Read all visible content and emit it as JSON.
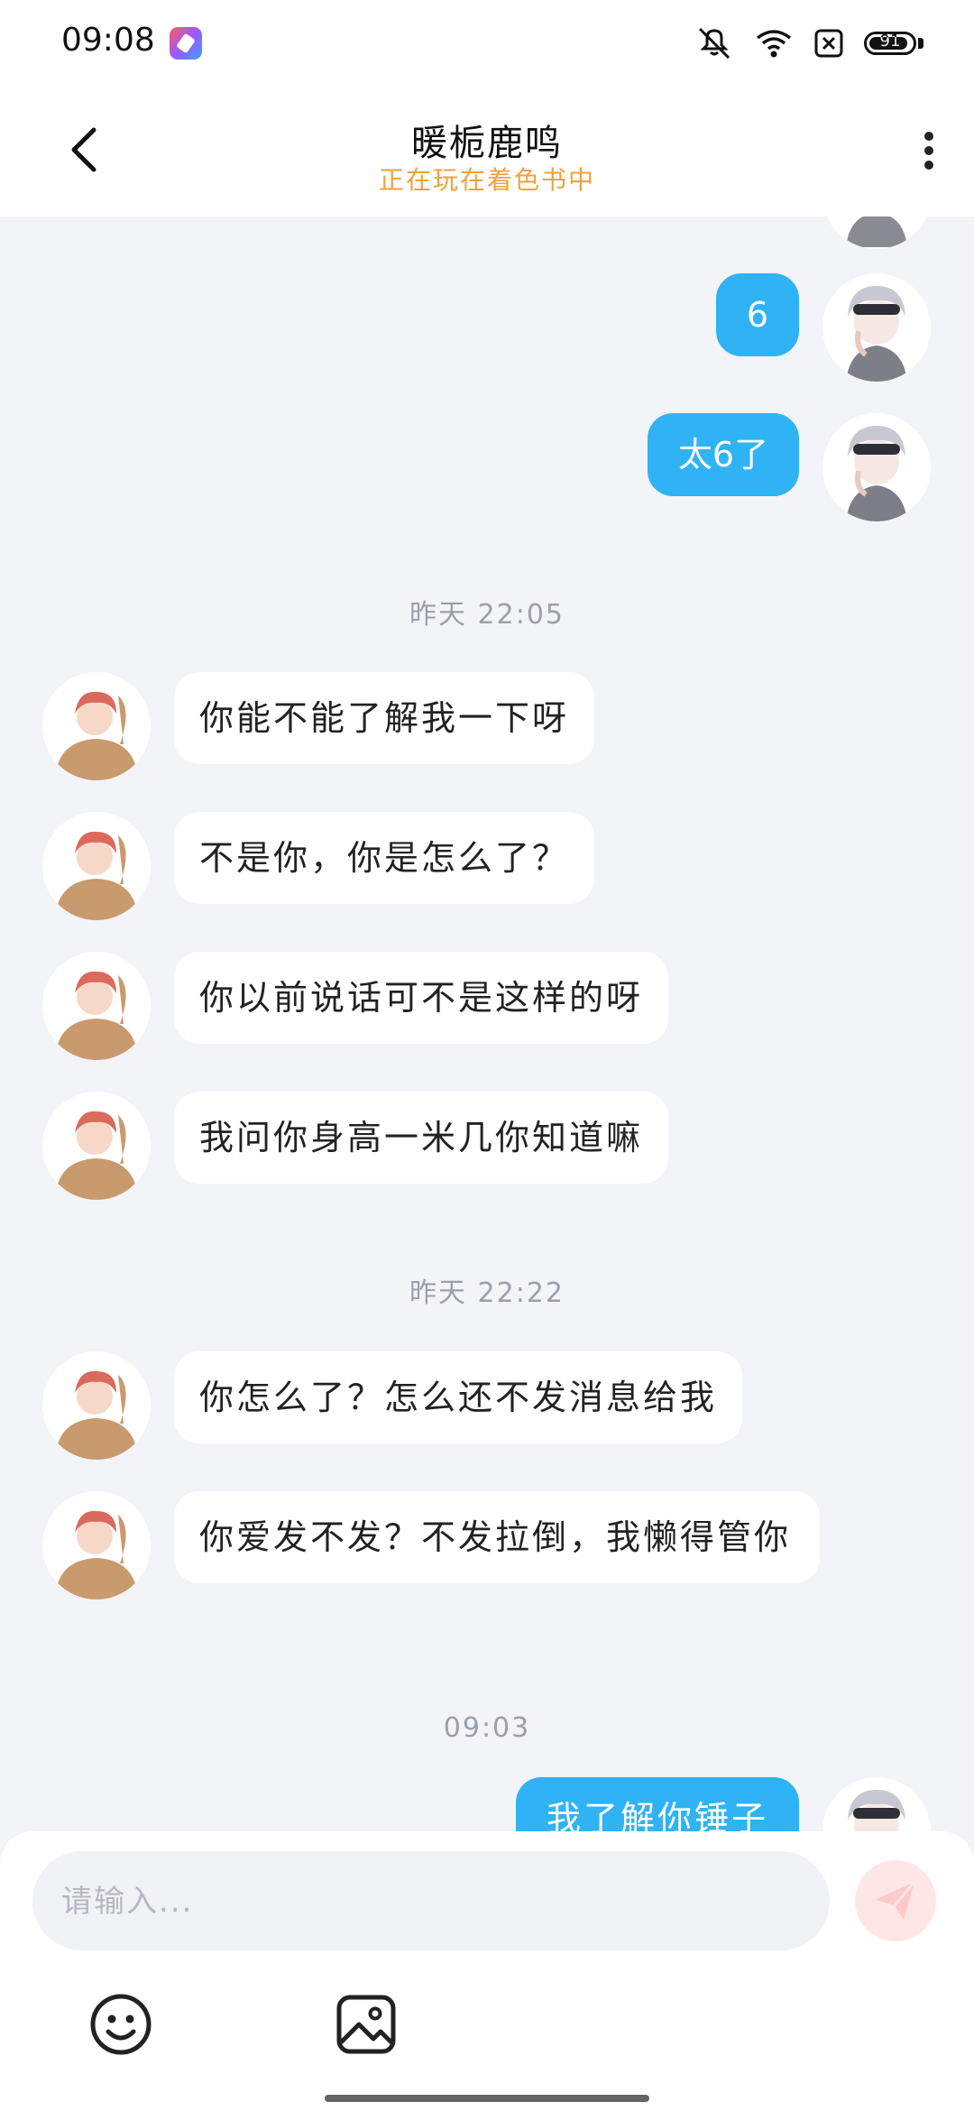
{
  "status_bar": {
    "time": "09:08",
    "icons": [
      "app-badge-icon",
      "mute-icon",
      "wifi-icon",
      "sim-off-icon",
      "battery-icon"
    ],
    "battery_level": "91",
    "battery_fraction": 0.91
  },
  "header": {
    "title": "暖栀鹿鸣",
    "subtitle": "正在玩在着色书中",
    "back_icon": "chevron-left-icon",
    "more_icon": "more-vertical-icon"
  },
  "messages": {
    "sent_1": "6",
    "sent_2": "太6了",
    "time_1": "昨天 22:05",
    "recv_1": "你能不能了解我一下呀",
    "recv_2": "不是你，你是怎么了？",
    "recv_3": "你以前说话可不是这样的呀",
    "recv_4": "我问你身高一米几你知道嘛",
    "time_2": "昨天 22:22",
    "recv_5": "你怎么了？怎么还不发消息给我",
    "recv_6": "你爱发不发？不发拉倒，我懒得管你",
    "time_3": "09:03",
    "sent_3": "我了解你锤子"
  },
  "input": {
    "placeholder": "请输入...",
    "value": ""
  },
  "toolbar": {
    "emoji_icon": "emoji-icon",
    "image_icon": "image-icon",
    "send_icon": "send-icon"
  },
  "colors": {
    "sent_bubble": "#2fb3f5",
    "subtitle": "#f0a23a",
    "background": "#f3f4f8",
    "send_button": "#ffe6e6"
  }
}
